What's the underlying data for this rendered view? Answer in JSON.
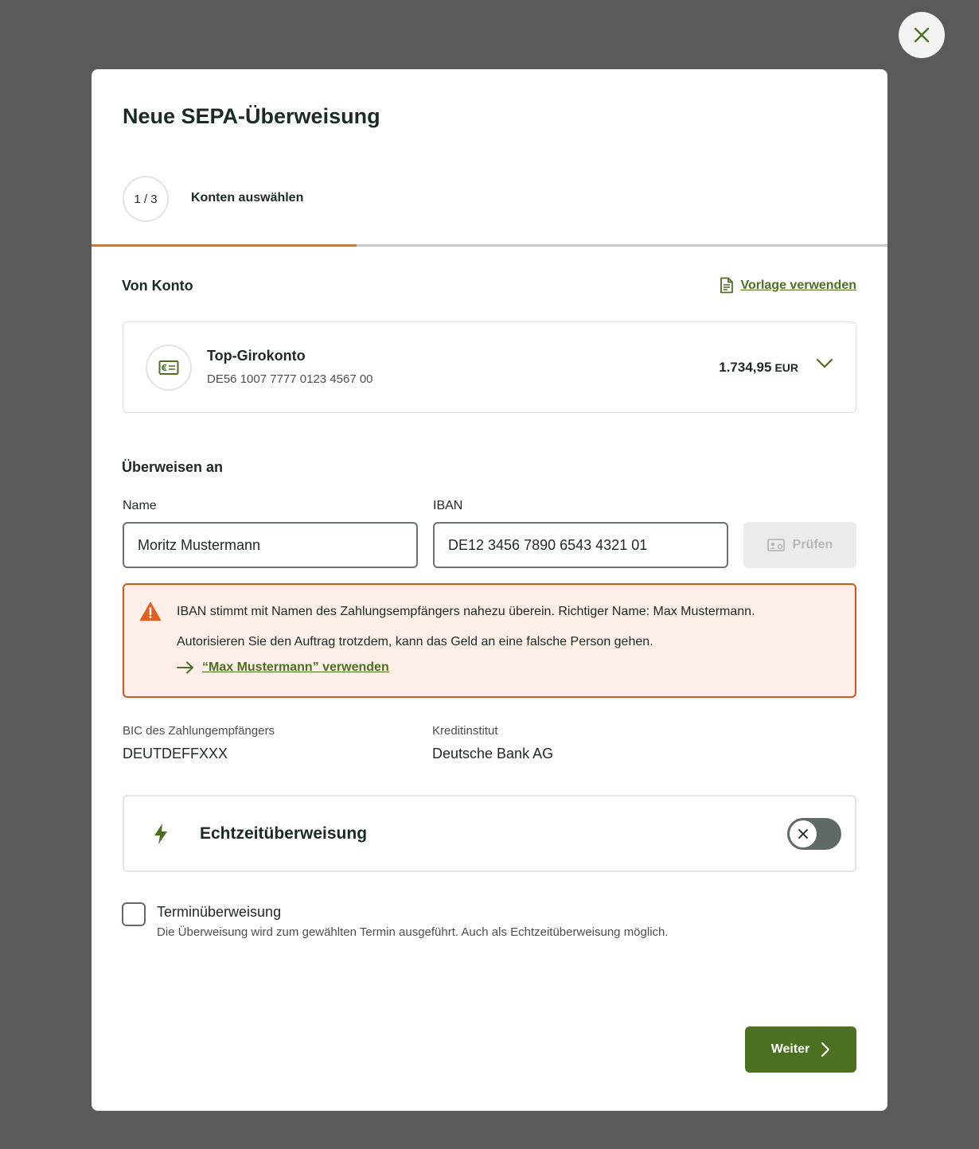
{
  "modal": {
    "title": "Neue SEPA-Überweisung",
    "step_counter": "1 / 3",
    "step_label": "Konten auswählen",
    "progress_fraction": 0.333
  },
  "from_account": {
    "section_label": "Von Konto",
    "template_link": "Vorlage verwenden",
    "name": "Top-Girokonto",
    "iban": "DE56 1007 7777 0123 4567 00",
    "balance": "1.734,95",
    "currency": "EUR"
  },
  "recipient": {
    "section_label": "Überweisen an",
    "name_label": "Name",
    "name_value": "Moritz Mustermann",
    "iban_label": "IBAN",
    "iban_value": "DE12 3456 7890 6543 4321 01",
    "check_button": "Prüfen"
  },
  "warning": {
    "line1": "IBAN stimmt mit Namen des Zahlungsempfängers nahezu überein. Richtiger Name: Max Mustermann.",
    "line2": "Autorisieren Sie den Auftrag trotzdem, kann das Geld an eine falsche Person gehen.",
    "action": "“Max Mustermann” verwenden"
  },
  "bank_info": {
    "bic_label": "BIC des Zahlungempfängers",
    "bic_value": "DEUTDEFFXXX",
    "bank_label": "Kreditinstitut",
    "bank_value": "Deutsche Bank AG"
  },
  "instant_transfer": {
    "label": "Echtzeitüberweisung",
    "enabled": false
  },
  "scheduled_transfer": {
    "label": "Terminüberweisung",
    "description": "Die Überweisung wird zum gewählten Termin ausgeführt. Auch als Echtzeitüberweisung möglich.",
    "checked": false
  },
  "footer": {
    "next_button": "Weiter"
  },
  "colors": {
    "accent_green": "#4a7020",
    "progress_orange": "#e8711f",
    "warning_border": "#d8541f",
    "warning_bg": "#fdeee8",
    "overlay": "#5a5a5a"
  },
  "icons": {
    "close": "close-icon",
    "template": "document-icon",
    "account": "euro-card-icon",
    "chevron": "chevron-down-icon",
    "check": "id-card-icon",
    "warning": "warning-triangle-icon",
    "arrow": "arrow-right-icon",
    "instant": "lightning-icon",
    "toggle": "x-icon",
    "next": "chevron-right-icon"
  }
}
